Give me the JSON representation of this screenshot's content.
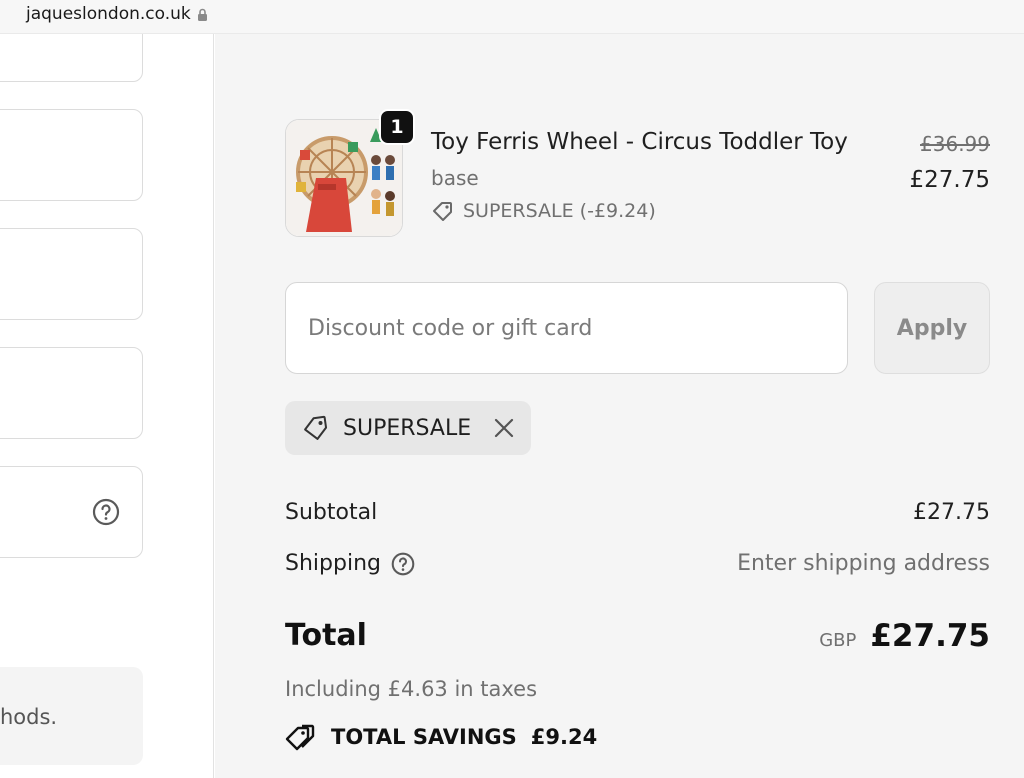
{
  "browser": {
    "url": "jaqueslondon.co.uk"
  },
  "left": {
    "note_text": "hods."
  },
  "item": {
    "quantity": "1",
    "title": "Toy Ferris Wheel - Circus Toddler Toy",
    "variant": "base",
    "discount_line": "SUPERSALE (-£9.24)",
    "price_original": "£36.99",
    "price_current": "£27.75"
  },
  "discount": {
    "placeholder": "Discount code or gift card",
    "apply_label": "Apply",
    "applied_code": "SUPERSALE"
  },
  "summary": {
    "subtotal_label": "Subtotal",
    "subtotal_value": "£27.75",
    "shipping_label": "Shipping",
    "shipping_value": "Enter shipping address",
    "total_label": "Total",
    "currency": "GBP",
    "total_value": "£27.75",
    "taxes_note": "Including £4.63 in taxes",
    "savings_label": "TOTAL SAVINGS",
    "savings_value": "£9.24"
  },
  "icons": {
    "lock": "lock-icon",
    "help": "help-circle-icon",
    "tag": "tag-icon",
    "close": "close-icon",
    "savings_tags": "tags-icon"
  }
}
